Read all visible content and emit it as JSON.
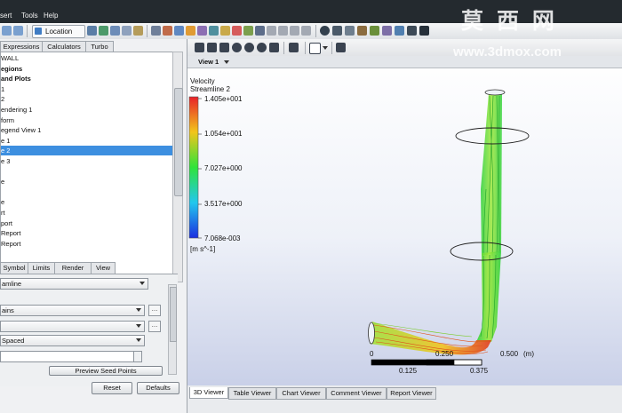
{
  "menu": {
    "items": [
      "sert",
      "Tools",
      "Help"
    ]
  },
  "toolbar": {
    "location_label": "Location"
  },
  "left_panel": {
    "top_tabs": [
      "Expressions",
      "Calculators",
      "Turbo"
    ],
    "tree": [
      {
        "label": "WALL",
        "bold": false,
        "selected": false
      },
      {
        "label": "egions",
        "bold": true,
        "selected": false
      },
      {
        "label": " and Plots",
        "bold": true,
        "selected": false
      },
      {
        "label": "1",
        "bold": false,
        "selected": false
      },
      {
        "label": "2",
        "bold": false,
        "selected": false
      },
      {
        "label": "endering 1",
        "bold": false,
        "selected": false
      },
      {
        "label": "form",
        "bold": false,
        "selected": false
      },
      {
        "label": "egend View 1",
        "bold": false,
        "selected": false
      },
      {
        "label": "e 1",
        "bold": false,
        "selected": false
      },
      {
        "label": "e 2",
        "bold": false,
        "selected": true
      },
      {
        "label": "e 3",
        "bold": false,
        "selected": false
      },
      {
        "label": "",
        "bold": false,
        "selected": false
      },
      {
        "label": "e",
        "bold": false,
        "selected": false
      },
      {
        "label": "",
        "bold": false,
        "selected": false
      },
      {
        "label": "e",
        "bold": false,
        "selected": false
      },
      {
        "label": "rt",
        "bold": false,
        "selected": false
      },
      {
        "label": "port",
        "bold": false,
        "selected": false
      },
      {
        "label": "Report",
        "bold": false,
        "selected": false
      },
      {
        "label": "Report",
        "bold": false,
        "selected": false
      }
    ],
    "detail_tabs": [
      "Symbol",
      "Limits",
      "Render",
      "View"
    ],
    "fields": {
      "type": "amline",
      "domains": "ains",
      "start_from": "",
      "sampling": "Spaced",
      "number": ""
    },
    "preview_button": "Preview Seed Points",
    "reset_button": "Reset",
    "defaults_button": "Defaults"
  },
  "viewer": {
    "view_label": "View 1",
    "legend": {
      "title": "Velocity",
      "subtitle": "Streamline 2",
      "ticks": [
        "1.405e+001",
        "1.054e+001",
        "7.027e+000",
        "3.517e+000",
        "7.068e-003"
      ],
      "unit": "[m s^-1]"
    },
    "scale": {
      "top_labels": [
        "0",
        "0.250",
        "0.500",
        "(m)"
      ],
      "bottom_labels": [
        "0.125",
        "0.375"
      ]
    },
    "bottom_tabs": [
      "3D Viewer",
      "Table Viewer",
      "Chart Viewer",
      "Comment Viewer",
      "Report Viewer"
    ]
  },
  "watermark": {
    "cn": "莫 西 网",
    "url": "www.3dmox.com"
  }
}
